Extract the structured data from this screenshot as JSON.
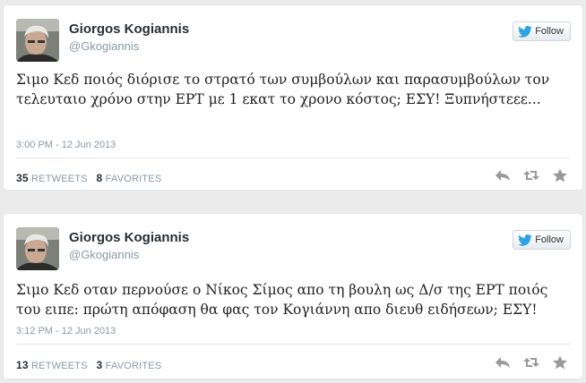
{
  "tweets": [
    {
      "name": "Giorgos Kogiannis",
      "handle": "@Gkogiannis",
      "follow_label": "Follow",
      "text": "Σιμο Κεδ ποιός διόρισε το στρατό των συμβούλων και παρασυμβούλων τον τελευταιο χρόνο στην ΕΡΤ με 1 εκατ το χρονο κόστος;  ΕΣΥ! Ξυπνήστεεε...",
      "timestamp": "3:00 PM - 12 Jun 2013",
      "retweets_count": "35",
      "retweets_label": "RETWEETS",
      "favorites_count": "8",
      "favorites_label": "FAVORITES"
    },
    {
      "name": "Giorgos Kogiannis",
      "handle": "@Gkogiannis",
      "follow_label": "Follow",
      "text": "Σιμο Κεδ οταν  περνούσε ο Νίκος Σίμος απο τη βουλη ως Δ/σ της ΕΡΤ ποιός του ειπε: πρώτη απόφαση θα φας τον Κογιάννη απο διευθ ειδήσεων; ΕΣΥ!",
      "timestamp": "3:12 PM - 12 Jun 2013",
      "retweets_count": "13",
      "retweets_label": "RETWEETS",
      "favorites_count": "3",
      "favorites_label": "FAVORITES"
    }
  ],
  "icons": {
    "follow": "twitter-bird-icon",
    "reply": "reply-icon",
    "retweet": "retweet-icon",
    "favorite": "star-icon"
  },
  "colors": {
    "twitter_blue": "#2ea3e3",
    "action_gray": "#999999",
    "muted_text": "#8899a6"
  }
}
